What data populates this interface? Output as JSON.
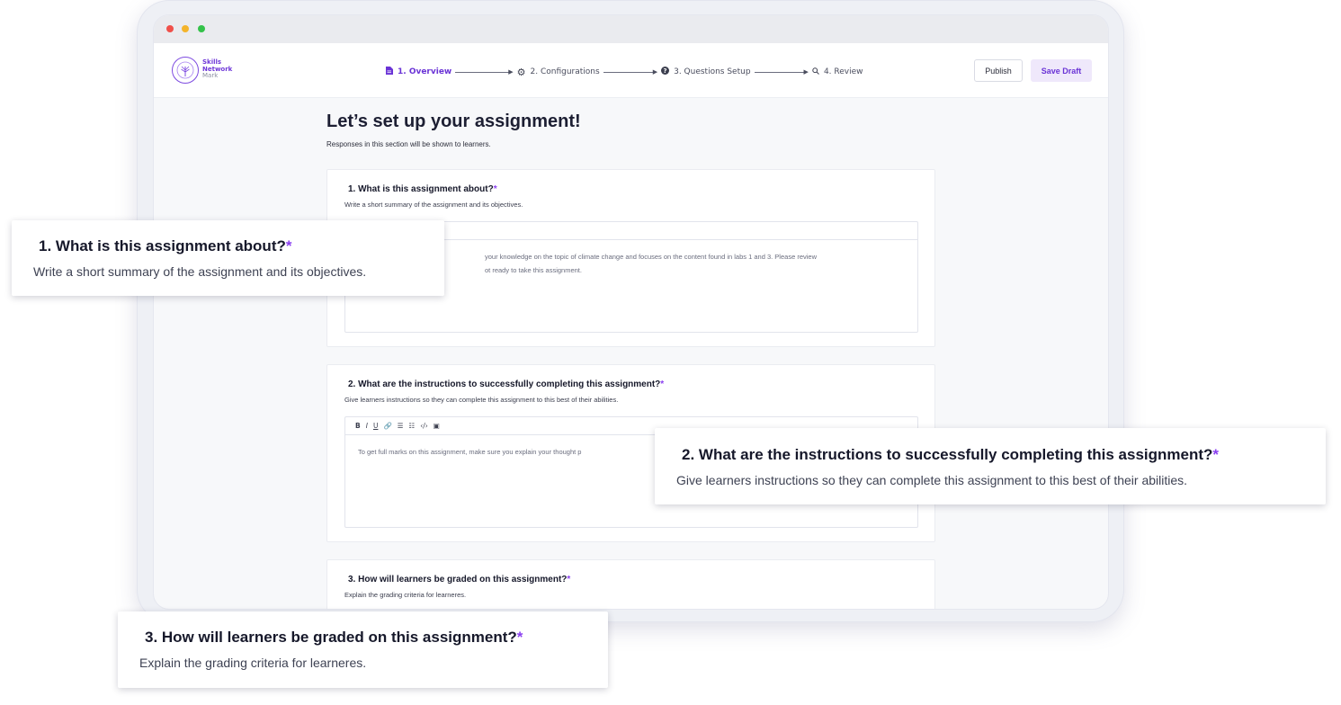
{
  "brand": {
    "line1": "Skills",
    "line2": "Network",
    "line3": "Mark"
  },
  "steps": [
    {
      "label": "1. Overview",
      "icon": "document-icon",
      "active": true
    },
    {
      "label": "2. Configurations",
      "icon": "gear-icon",
      "active": false
    },
    {
      "label": "3. Questions Setup",
      "icon": "question-circle-icon",
      "active": false
    },
    {
      "label": "4. Review",
      "icon": "search-icon",
      "active": false
    }
  ],
  "actions": {
    "publish": "Publish",
    "save_draft": "Save Draft"
  },
  "page": {
    "title": "Let’s set up your assignment!",
    "subtitle": "Responses in this section will be shown to learners."
  },
  "sections": [
    {
      "question": "1. What is this assignment about?",
      "required_mark": "*",
      "description": "Write a short summary of the assignment and its objectives.",
      "editor_line1": "your knowledge on the topic of climate change and focuses on the content found in labs 1 and 3. Please review",
      "editor_line2": "ot ready to take this assignment."
    },
    {
      "question": "2. What are the instructions to successfully completing this assignment?",
      "required_mark": "*",
      "description": "Give learners instructions so they can complete this assignment to this best of their abilities.",
      "editor_line1": "To get full marks on this assignment, make sure you explain your thought p"
    },
    {
      "question": "3. How will learners be graded on this assignment?",
      "required_mark": "*",
      "description": "Explain the grading criteria for learneres."
    }
  ],
  "toolbar": {
    "bold": "B",
    "italic": "I",
    "underline": "U",
    "link": "🔗",
    "bullets": "☰",
    "numbers": "☷",
    "code": "‹/›",
    "image": "▣"
  },
  "colors": {
    "accent": "#6a33d6",
    "required": "#8a3ff0"
  }
}
